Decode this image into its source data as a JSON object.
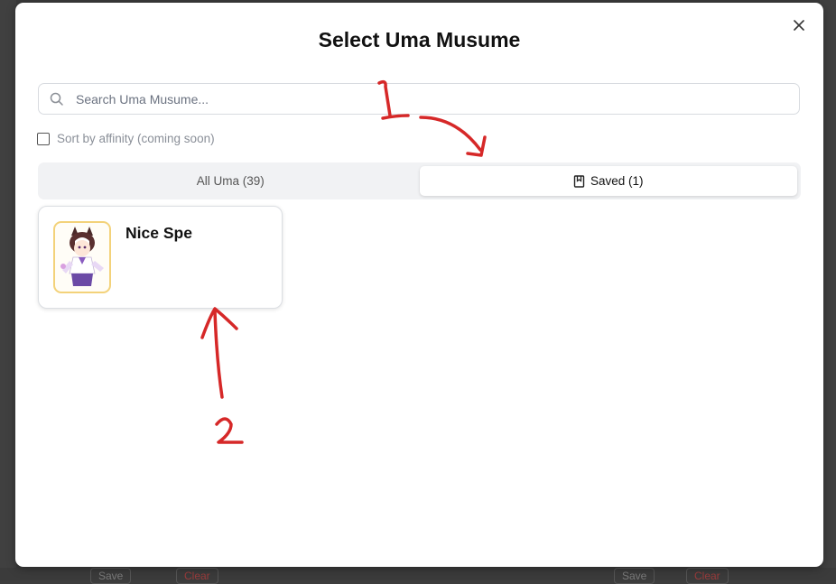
{
  "background": {
    "footer_buttons": [
      {
        "label": "Save"
      },
      {
        "label": "Clear"
      },
      {
        "label": "Save"
      },
      {
        "label": "Clear"
      }
    ]
  },
  "modal": {
    "title": "Select Uma Musume",
    "close_icon": "close-icon",
    "search": {
      "placeholder": "Search Uma Musume...",
      "value": "",
      "icon": "search-icon"
    },
    "sort": {
      "label": "Sort by affinity (coming soon)",
      "checked": false
    },
    "tabs": [
      {
        "label": "All Uma (39)",
        "active": false
      },
      {
        "label": "Saved (1)",
        "active": true,
        "icon": "bookmark-icon"
      }
    ],
    "cards": [
      {
        "name": "Nice Spe"
      }
    ]
  },
  "annotations": {
    "color": "#d62828",
    "labels": [
      "1",
      "2"
    ]
  }
}
